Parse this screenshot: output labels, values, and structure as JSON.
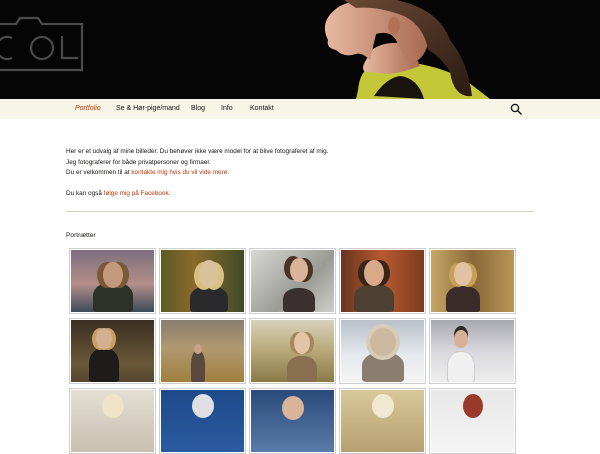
{
  "nav": {
    "items": [
      {
        "label": "Portfolio",
        "active": true
      },
      {
        "label": "Se & Hør-pige/mand",
        "active": false
      },
      {
        "label": "Blog",
        "active": false
      },
      {
        "label": "Info",
        "active": false
      },
      {
        "label": "Kontakt",
        "active": false
      }
    ],
    "search_icon": "search-icon",
    "colors": {
      "background": "#f7f5e7",
      "active": "#bc360a",
      "text": "#141412"
    }
  },
  "content": {
    "line1": "Her er et udvalg af mine billeder. Du behøver ikke være model for at blive fotograferet af mig.",
    "line2": "Jeg fotograferer for både privatpersoner og firmaer.",
    "line3_prefix": "Du er velkommen til at ",
    "line3_link": "kontakte mig hvis du vil vide mere.",
    "line4_prefix": "Du kan også ",
    "line4_link": "følge mig på Facebook."
  },
  "gallery": {
    "title": "Portrætter"
  }
}
